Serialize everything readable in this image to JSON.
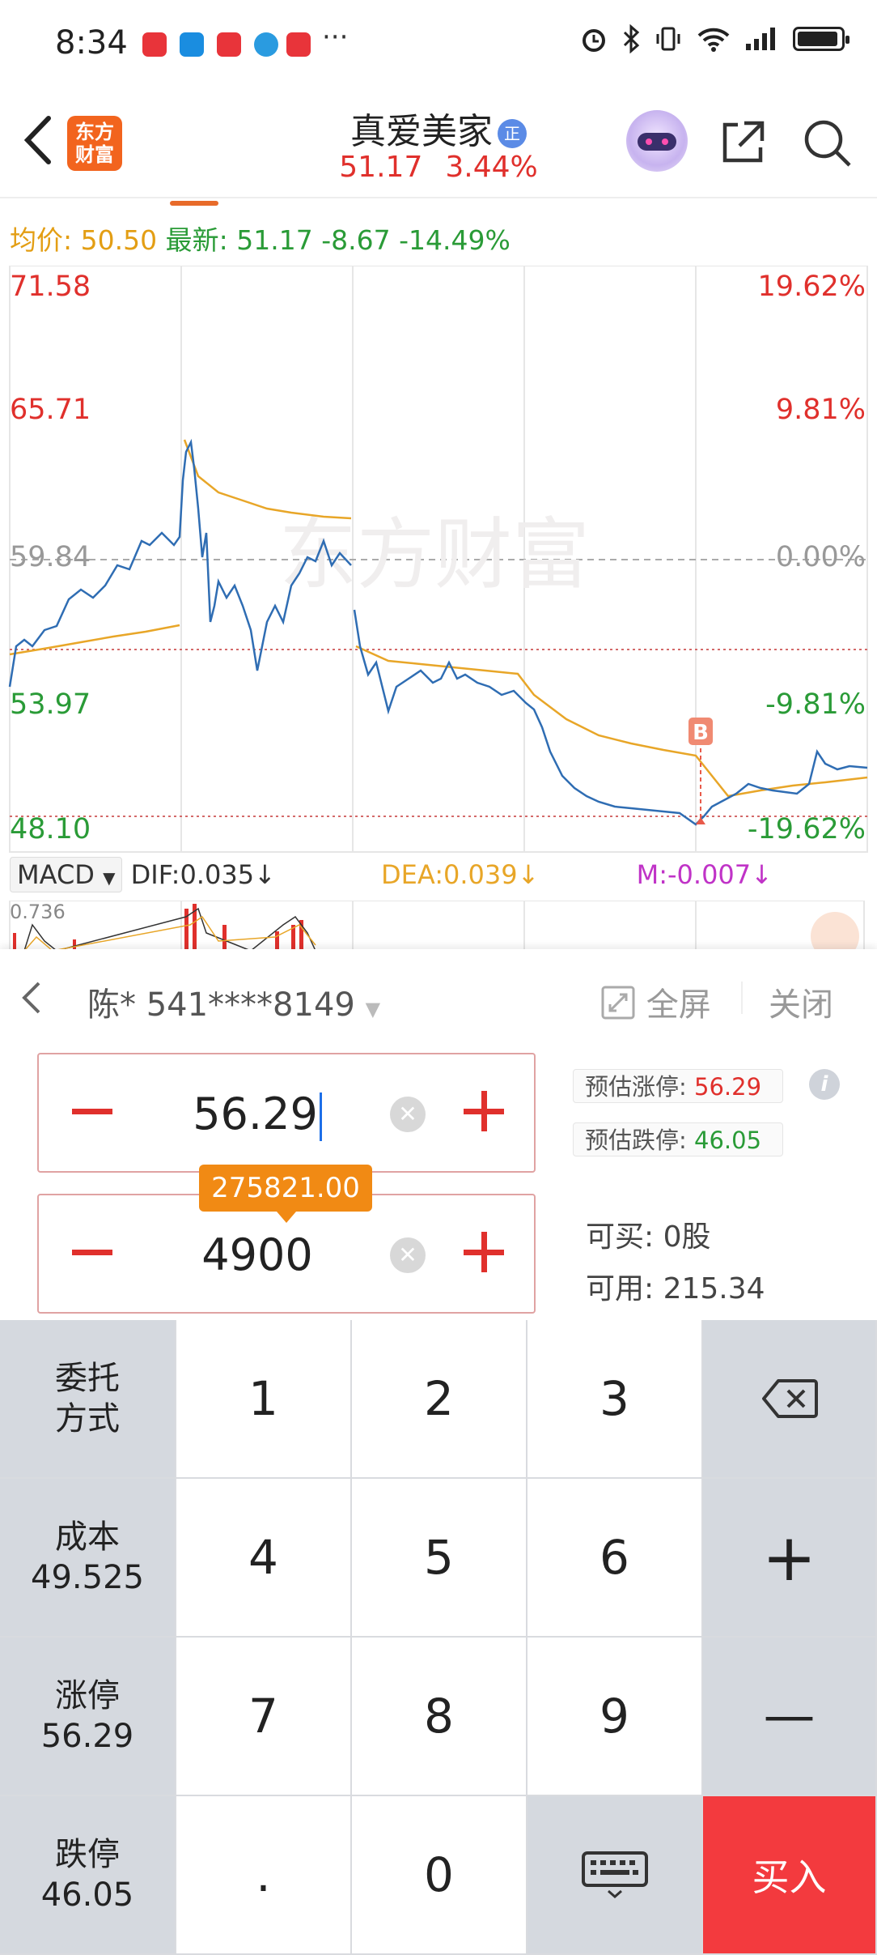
{
  "status_bar": {
    "time": "8:34",
    "more": "···"
  },
  "header": {
    "back_label": "‹",
    "logo_line1": "东方",
    "logo_line2": "财富",
    "stock_name": "真爱美家",
    "stock_badge": "正",
    "price": "51.17",
    "change_pct": "3.44%"
  },
  "price_row": {
    "avg_label": "均价:",
    "avg_value": "50.50",
    "latest_label": "最新:",
    "latest_value": "51.17",
    "change": "-8.67",
    "change_pct": "-14.49%"
  },
  "chart": {
    "watermark": "东方财富",
    "left_axis": [
      "71.58",
      "65.71",
      "59.84",
      "53.97",
      "48.10"
    ],
    "right_axis": [
      "19.62%",
      "9.81%",
      "0.00%",
      "-9.81%",
      "-19.62%"
    ],
    "buy_marker": "B",
    "colors": {
      "price_line": "#2f6db3",
      "avg_line": "#e8a628",
      "up": "#e0302c",
      "down": "#2a9b37"
    }
  },
  "macd": {
    "selector": "MACD",
    "dif": "DIF:0.035",
    "dif_arrow": "↓",
    "dea": "DEA:0.039",
    "dea_arrow": "↓",
    "m": "M:-0.007",
    "m_arrow": "↓",
    "scale_top": "0.736"
  },
  "account": {
    "name": "陈* 541****8149",
    "fullscreen": "全屏",
    "close": "关闭"
  },
  "order": {
    "price_value": "56.29",
    "qty_value": "4900",
    "amount_tip": "275821.00",
    "est_up_label": "预估涨停:",
    "est_up_value": "56.29",
    "est_down_label": "预估跌停:",
    "est_down_value": "46.05",
    "can_buy_label": "可买:",
    "can_buy_value": "0股",
    "available_label": "可用:",
    "available_value": "215.34",
    "info_icon": "i"
  },
  "keypad": {
    "side": [
      {
        "line1": "委托",
        "line2": "方式"
      },
      {
        "line1": "成本",
        "line2": "49.525"
      },
      {
        "line1": "涨停",
        "line2": "56.29"
      },
      {
        "line1": "跌停",
        "line2": "46.05"
      }
    ],
    "digits": [
      "1",
      "2",
      "3",
      "4",
      "5",
      "6",
      "7",
      "8",
      "9",
      ".",
      "0"
    ],
    "plus": "+",
    "minus": "—",
    "buy": "买入"
  }
}
